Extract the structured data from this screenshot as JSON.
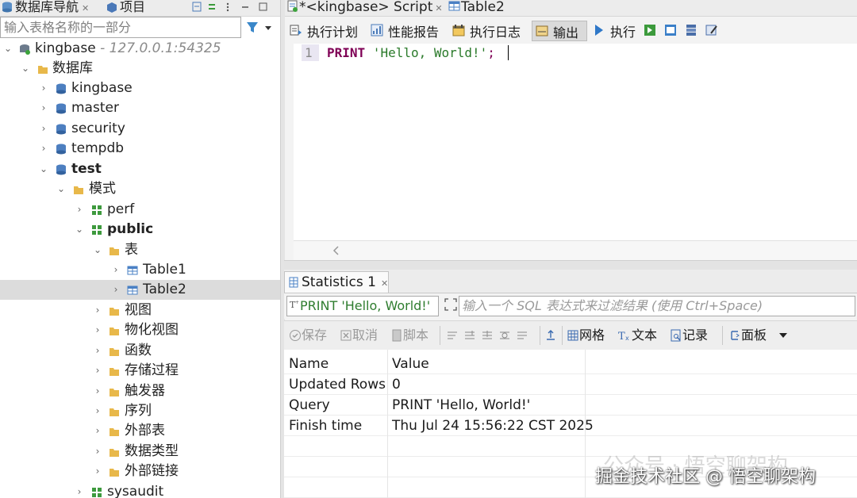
{
  "left_panel": {
    "tabs": [
      {
        "label": "数据库导航",
        "close": "✕"
      },
      {
        "label": "项目"
      }
    ],
    "search_placeholder": "输入表格名称的一部分",
    "tree": {
      "connection": {
        "label": "kingbase",
        "host": " - 127.0.0.1:54325"
      },
      "databases_folder": "数据库",
      "databases": [
        "kingbase",
        "master",
        "security",
        "tempdb",
        "test"
      ],
      "schemas_folder": "模式",
      "schemas": [
        "perf",
        "public"
      ],
      "tables_folder": "表",
      "tables": [
        "Table1",
        "Table2"
      ],
      "public_folders": [
        "视图",
        "物化视图",
        "函数",
        "存储过程",
        "触发器",
        "序列",
        "外部表",
        "数据类型",
        "外部链接"
      ],
      "last_schema": "sysaudit"
    }
  },
  "editor": {
    "tabs": [
      {
        "label": "*<kingbase> Script",
        "close": "✕"
      },
      {
        "label": "Table2"
      }
    ],
    "toolbar": {
      "plan": "执行计划",
      "perf": "性能报告",
      "log": "执行日志",
      "output": "输出",
      "execute": "执行"
    },
    "line_number": "1",
    "code": {
      "kw": "PRINT",
      "str": " 'Hello, World!'",
      "punct": ";"
    }
  },
  "results": {
    "tab_label": "Statistics 1",
    "tab_close": "✕",
    "filter_query": "PRINT 'Hello, World!'",
    "filter_placeholder": "输入一个 SQL 表达式来过滤结果 (使用 Ctrl+Space)",
    "toolbar": {
      "save": "保存",
      "cancel": "取消",
      "script": "脚本",
      "grid": "网格",
      "text": "文本",
      "record": "记录",
      "panel": "面板"
    },
    "columns": [
      "Name",
      "Value"
    ],
    "rows": [
      {
        "name": "Updated Rows",
        "value": "0"
      },
      {
        "name": "Query",
        "value": "PRINT 'Hello, World!'"
      },
      {
        "name": "Finish time",
        "value": "Thu Jul 24 15:56:22 CST 2025"
      }
    ]
  },
  "watermark": {
    "faded": "公众号 · 悟空聊架构",
    "text": "掘金技术社区 @ 悟空聊架构"
  }
}
